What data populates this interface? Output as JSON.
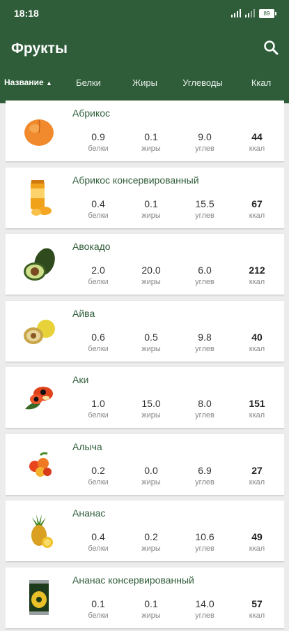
{
  "status": {
    "time": "18:18",
    "battery": "89"
  },
  "appbar": {
    "title": "Фрукты"
  },
  "columns": {
    "name": "Название",
    "sort_arrow": "▲",
    "protein": "Белки",
    "fat": "Жиры",
    "carbs": "Углеводы",
    "kcal": "Ккал"
  },
  "labels": {
    "protein": "белки",
    "fat": "жиры",
    "carbs": "углев",
    "kcal": "ккал"
  },
  "items": [
    {
      "name": "Абрикос",
      "protein": "0.9",
      "fat": "0.1",
      "carbs": "9.0",
      "kcal": "44",
      "icon": "apricot-icon"
    },
    {
      "name": "Абрикос консервированный",
      "protein": "0.4",
      "fat": "0.1",
      "carbs": "15.5",
      "kcal": "67",
      "icon": "canned-apricot-icon"
    },
    {
      "name": "Авокадо",
      "protein": "2.0",
      "fat": "20.0",
      "carbs": "6.0",
      "kcal": "212",
      "icon": "avocado-icon"
    },
    {
      "name": "Айва",
      "protein": "0.6",
      "fat": "0.5",
      "carbs": "9.8",
      "kcal": "40",
      "icon": "quince-icon"
    },
    {
      "name": "Аки",
      "protein": "1.0",
      "fat": "15.0",
      "carbs": "8.0",
      "kcal": "151",
      "icon": "ackee-icon"
    },
    {
      "name": "Алыча",
      "protein": "0.2",
      "fat": "0.0",
      "carbs": "6.9",
      "kcal": "27",
      "icon": "cherry-plum-icon"
    },
    {
      "name": "Ананас",
      "protein": "0.4",
      "fat": "0.2",
      "carbs": "10.6",
      "kcal": "49",
      "icon": "pineapple-icon"
    },
    {
      "name": "Ананас консервированный",
      "protein": "0.1",
      "fat": "0.1",
      "carbs": "14.0",
      "kcal": "57",
      "icon": "canned-pineapple-icon"
    }
  ]
}
